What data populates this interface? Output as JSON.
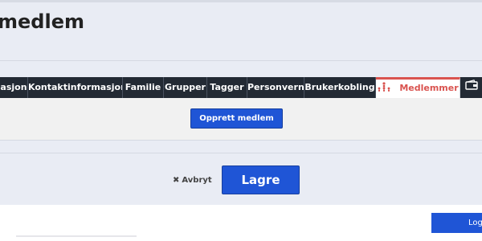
{
  "page": {
    "title": "medlem"
  },
  "tabs": [
    {
      "label": "asjon"
    },
    {
      "label": "Kontaktinformasjon"
    },
    {
      "label": "Familie"
    },
    {
      "label": "Grupper"
    },
    {
      "label": "Tagger"
    },
    {
      "label": "Personvern"
    },
    {
      "label": "Brukerkobling"
    },
    {
      "label": "Medlemmer",
      "active": true,
      "icon": "members-icon"
    },
    {
      "label": "",
      "icon": "wallet-icon"
    }
  ],
  "panel": {
    "create_member_label": "Opprett medlem"
  },
  "actions": {
    "cancel_label": "Avbryt",
    "save_label": "Lagre"
  },
  "footer": {
    "logout_label": "Log"
  },
  "colors": {
    "primary": "#1f55d6",
    "active_tab": "#d9534f",
    "tabbar": "#232a34"
  }
}
